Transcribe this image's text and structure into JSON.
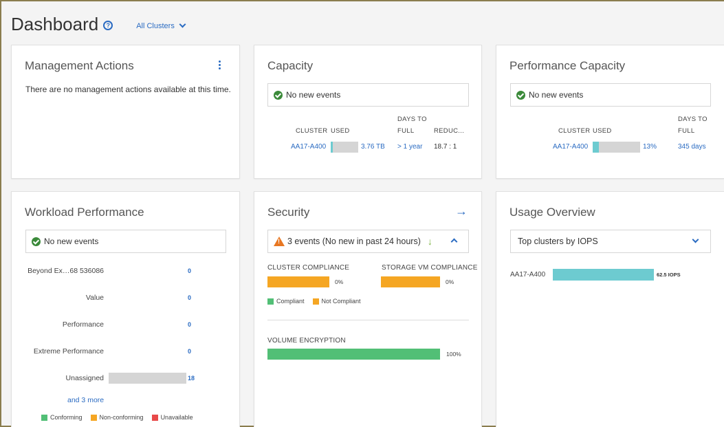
{
  "header": {
    "title": "Dashboard",
    "help_icon": "?",
    "cluster_filter": "All Clusters"
  },
  "colors": {
    "accent": "#2a6bc2",
    "teal": "#6dcbd0",
    "green": "#52bf76",
    "orange": "#f5a623",
    "red": "#e84a4a",
    "track": "#d5d5d5"
  },
  "management_actions": {
    "title": "Management Actions",
    "message": "There are no management actions available at this time."
  },
  "capacity": {
    "title": "Capacity",
    "events": "No new events",
    "columns": [
      "CLUSTER",
      "USED",
      "DAYS TO",
      "FULL",
      "REDUC..."
    ],
    "row": {
      "cluster": "AA17-A400",
      "used_fraction": 0.08,
      "used": "3.76 TB",
      "days_to_full": "> 1 year",
      "reduction": "18.7 : 1"
    }
  },
  "performance_capacity": {
    "title": "Performance Capacity",
    "events": "No new events",
    "columns": [
      "CLUSTER",
      "USED",
      "DAYS TO",
      "FULL"
    ],
    "row": {
      "cluster": "AA17-A400",
      "used_fraction": 0.13,
      "used": "13%",
      "days_to_full": "345 days"
    }
  },
  "workload_performance": {
    "title": "Workload Performance",
    "events": "No new events",
    "rows": [
      {
        "label": "Beyond Ex…68 536086",
        "value": "0",
        "fraction": 0
      },
      {
        "label": "Value",
        "value": "0",
        "fraction": 0
      },
      {
        "label": "Performance",
        "value": "0",
        "fraction": 0
      },
      {
        "label": "Extreme Performance",
        "value": "0",
        "fraction": 0
      },
      {
        "label": "Unassigned",
        "value": "18",
        "fraction": 1
      }
    ],
    "more_link": "and 3 more",
    "legend": [
      "Conforming",
      "Non-conforming",
      "Unavailable"
    ]
  },
  "security": {
    "title": "Security",
    "events": "3 events (No new in past 24 hours)",
    "cluster_compliance": {
      "label": "CLUSTER COMPLIANCE",
      "value": "0%",
      "compliant_fraction": 0
    },
    "svm_compliance": {
      "label": "STORAGE VM COMPLIANCE",
      "value": "0%",
      "compliant_fraction": 0
    },
    "legend": [
      "Compliant",
      "Not Compliant"
    ],
    "volume_encryption": {
      "label": "VOLUME ENCRYPTION",
      "value": "100%",
      "fraction": 1
    }
  },
  "usage_overview": {
    "title": "Usage Overview",
    "selector": "Top clusters by IOPS",
    "row": {
      "cluster": "AA17-A400",
      "value": "62.5 IOPS",
      "fraction": 1
    }
  }
}
